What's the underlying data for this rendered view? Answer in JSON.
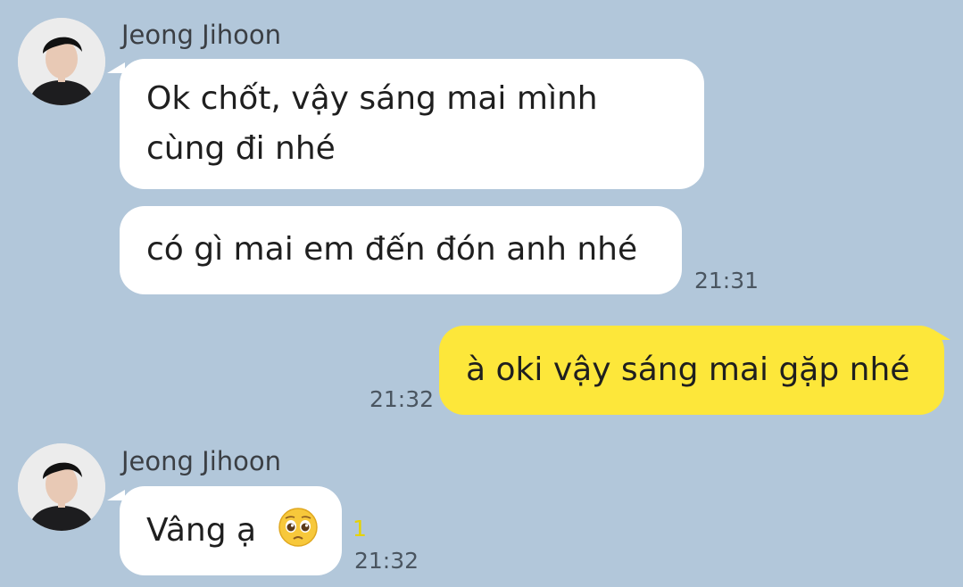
{
  "chat": {
    "colors": {
      "background": "#b2c7da",
      "incoming_bubble": "#ffffff",
      "outgoing_bubble": "#fde73a",
      "unread_badge": "#e6d200"
    },
    "messages": [
      {
        "direction": "incoming",
        "sender": "Jeong Jihoon",
        "lines": [
          "Ok chốt, vậy sáng mai mình",
          "cùng đi nhé"
        ]
      },
      {
        "direction": "incoming",
        "text": "có gì mai em đến đón anh nhé",
        "time": "21:31"
      },
      {
        "direction": "outgoing",
        "text": "à oki vậy sáng mai gặp nhé",
        "time": "21:32"
      },
      {
        "direction": "incoming",
        "sender": "Jeong Jihoon",
        "text": "Vâng ạ",
        "emoji": "pleading-face-emoji",
        "unread_count": "1",
        "time": "21:32"
      }
    ]
  }
}
